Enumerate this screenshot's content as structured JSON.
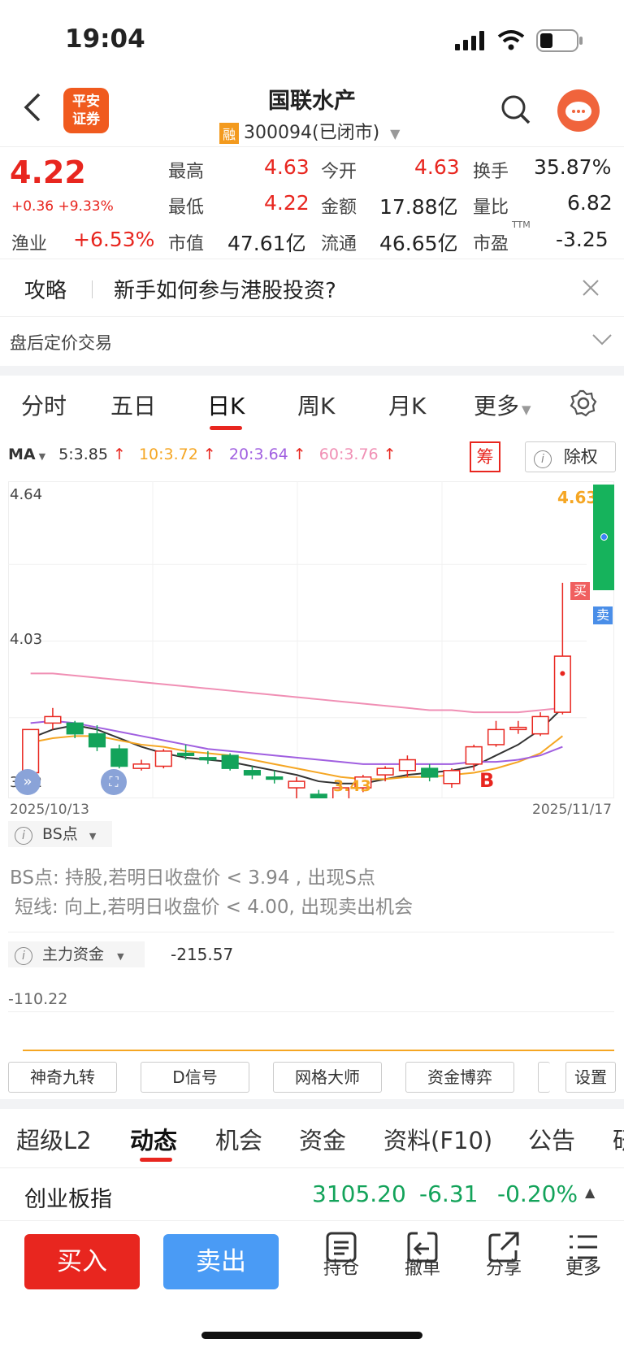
{
  "status": {
    "time": "19:04"
  },
  "header": {
    "logo_text_1": "平安",
    "logo_text_2": "证券",
    "title": "国联水产",
    "badge": "融",
    "code": "300094(已闭市)"
  },
  "quote": {
    "price": "4.22",
    "change": "+0.36 +9.33%",
    "industry_label": "渔业",
    "industry_chg": "+6.53%",
    "high_label": "最高",
    "high": "4.63",
    "low_label": "最低",
    "low": "4.22",
    "cap_label": "市值",
    "cap": "47.61亿",
    "open_label": "今开",
    "open": "4.63",
    "amount_label": "金额",
    "amount": "17.88亿",
    "float_label": "流通",
    "float": "46.65亿",
    "turnover_label": "换手",
    "turnover": "35.87%",
    "vol_ratio_label": "量比",
    "vol_ratio": "6.82",
    "pe_label": "市盈",
    "pe_sup": "TTM",
    "pe": "-3.25"
  },
  "tip": {
    "tag": "攻略",
    "text": "新手如何参与港股投资?"
  },
  "after_hours": "盘后定价交易",
  "tabs": [
    "分时",
    "五日",
    "日K",
    "周K",
    "月K",
    "更多"
  ],
  "ma": {
    "label": "MA",
    "m5": "5:3.85",
    "m10": "10:3.72",
    "m20": "20:3.64",
    "m60": "60:3.76",
    "chip": "筹",
    "exright": "除权",
    "color_m5": "#333333",
    "color_m10": "#f5a623",
    "color_m20": "#a05fe0",
    "color_m60": "#f08fb4"
  },
  "chart_data": {
    "type": "candlestick",
    "y_top_label": "4.64",
    "y_mid_label": "4.03",
    "y_bottom_label": "3.22",
    "ylim": [
      3.22,
      4.64
    ],
    "x_start": "2025/10/13",
    "x_end": "2025/11/17",
    "high_annotation": "4.63",
    "low_annotation": "3.43",
    "buy_mark": "买",
    "sell_mark": "卖",
    "b_mark": "B",
    "candles": [
      {
        "o": 3.32,
        "c": 3.52,
        "h": 3.52,
        "l": 3.3
      },
      {
        "o": 3.55,
        "c": 3.58,
        "h": 3.62,
        "l": 3.52
      },
      {
        "o": 3.55,
        "c": 3.5,
        "h": 3.56,
        "l": 3.48
      },
      {
        "o": 3.5,
        "c": 3.44,
        "h": 3.54,
        "l": 3.42
      },
      {
        "o": 3.43,
        "c": 3.35,
        "h": 3.45,
        "l": 3.34
      },
      {
        "o": 3.34,
        "c": 3.36,
        "h": 3.38,
        "l": 3.33
      },
      {
        "o": 3.35,
        "c": 3.42,
        "h": 3.43,
        "l": 3.34
      },
      {
        "o": 3.41,
        "c": 3.4,
        "h": 3.45,
        "l": 3.38
      },
      {
        "o": 3.39,
        "c": 3.38,
        "h": 3.42,
        "l": 3.36
      },
      {
        "o": 3.4,
        "c": 3.34,
        "h": 3.41,
        "l": 3.33
      },
      {
        "o": 3.33,
        "c": 3.31,
        "h": 3.35,
        "l": 3.29
      },
      {
        "o": 3.3,
        "c": 3.29,
        "h": 3.33,
        "l": 3.27
      },
      {
        "o": 3.25,
        "c": 3.28,
        "h": 3.3,
        "l": 3.18
      },
      {
        "o": 3.22,
        "c": 3.17,
        "h": 3.24,
        "l": 3.15
      },
      {
        "o": 3.17,
        "c": 3.25,
        "h": 3.27,
        "l": 3.15
      },
      {
        "o": 3.25,
        "c": 3.3,
        "h": 3.31,
        "l": 3.23
      },
      {
        "o": 3.31,
        "c": 3.34,
        "h": 3.35,
        "l": 3.28
      },
      {
        "o": 3.33,
        "c": 3.38,
        "h": 3.4,
        "l": 3.3
      },
      {
        "o": 3.34,
        "c": 3.3,
        "h": 3.36,
        "l": 3.28
      },
      {
        "o": 3.27,
        "c": 3.33,
        "h": 3.34,
        "l": 3.25
      },
      {
        "o": 3.36,
        "c": 3.44,
        "h": 3.45,
        "l": 3.33
      },
      {
        "o": 3.45,
        "c": 3.52,
        "h": 3.56,
        "l": 3.44
      },
      {
        "o": 3.52,
        "c": 3.53,
        "h": 3.56,
        "l": 3.5
      },
      {
        "o": 3.5,
        "c": 3.58,
        "h": 3.6,
        "l": 3.49
      },
      {
        "o": 3.6,
        "c": 3.86,
        "h": 4.2,
        "l": 3.59
      }
    ],
    "ma_series": [
      {
        "name": "MA5",
        "color": "#333333",
        "values": [
          3.48,
          3.52,
          3.54,
          3.52,
          3.48,
          3.44,
          3.41,
          3.39,
          3.38,
          3.37,
          3.35,
          3.33,
          3.31,
          3.28,
          3.27,
          3.27,
          3.29,
          3.31,
          3.32,
          3.33,
          3.35,
          3.4,
          3.45,
          3.52,
          3.62
        ]
      },
      {
        "name": "MA10",
        "color": "#f5a623",
        "values": [
          3.46,
          3.48,
          3.49,
          3.49,
          3.47,
          3.45,
          3.44,
          3.42,
          3.41,
          3.4,
          3.38,
          3.36,
          3.34,
          3.32,
          3.3,
          3.29,
          3.29,
          3.3,
          3.3,
          3.31,
          3.32,
          3.34,
          3.37,
          3.41,
          3.49
        ]
      },
      {
        "name": "MA20",
        "color": "#a05fe0",
        "values": [
          3.55,
          3.56,
          3.55,
          3.53,
          3.51,
          3.49,
          3.47,
          3.45,
          3.43,
          3.42,
          3.41,
          3.4,
          3.39,
          3.38,
          3.37,
          3.36,
          3.36,
          3.36,
          3.36,
          3.36,
          3.37,
          3.37,
          3.38,
          3.4,
          3.44
        ]
      },
      {
        "name": "MA60",
        "color": "#f08fb4",
        "values": [
          3.78,
          3.78,
          3.77,
          3.76,
          3.75,
          3.74,
          3.73,
          3.72,
          3.71,
          3.7,
          3.69,
          3.68,
          3.67,
          3.66,
          3.65,
          3.64,
          3.63,
          3.62,
          3.61,
          3.61,
          3.6,
          3.6,
          3.6,
          3.61,
          3.62
        ]
      }
    ]
  },
  "bs": {
    "label": "BS点",
    "line1": "BS点: 持股,若明日收盘价 < 3.94 , 出现S点",
    "line2": "短线: 向上,若明日收盘价 < 4.00, 出现卖出机会"
  },
  "funds": {
    "label": "主力资金",
    "value": "-215.57",
    "scale": "-110.22"
  },
  "indicator_chips": [
    "神奇九转",
    "D信号",
    "网格大师",
    "资金博弈",
    "设置"
  ],
  "bottom_tabs": [
    "超级L2",
    "动态",
    "机会",
    "资金",
    "资料(F10)",
    "公告",
    "研"
  ],
  "index": {
    "name": "创业板指",
    "value": "3105.20",
    "change": "-6.31",
    "pct": "-0.20%"
  },
  "actions": {
    "buy": "买入",
    "sell": "卖出",
    "position": "持仓",
    "cancel": "撤单",
    "share": "分享",
    "more": "更多"
  }
}
